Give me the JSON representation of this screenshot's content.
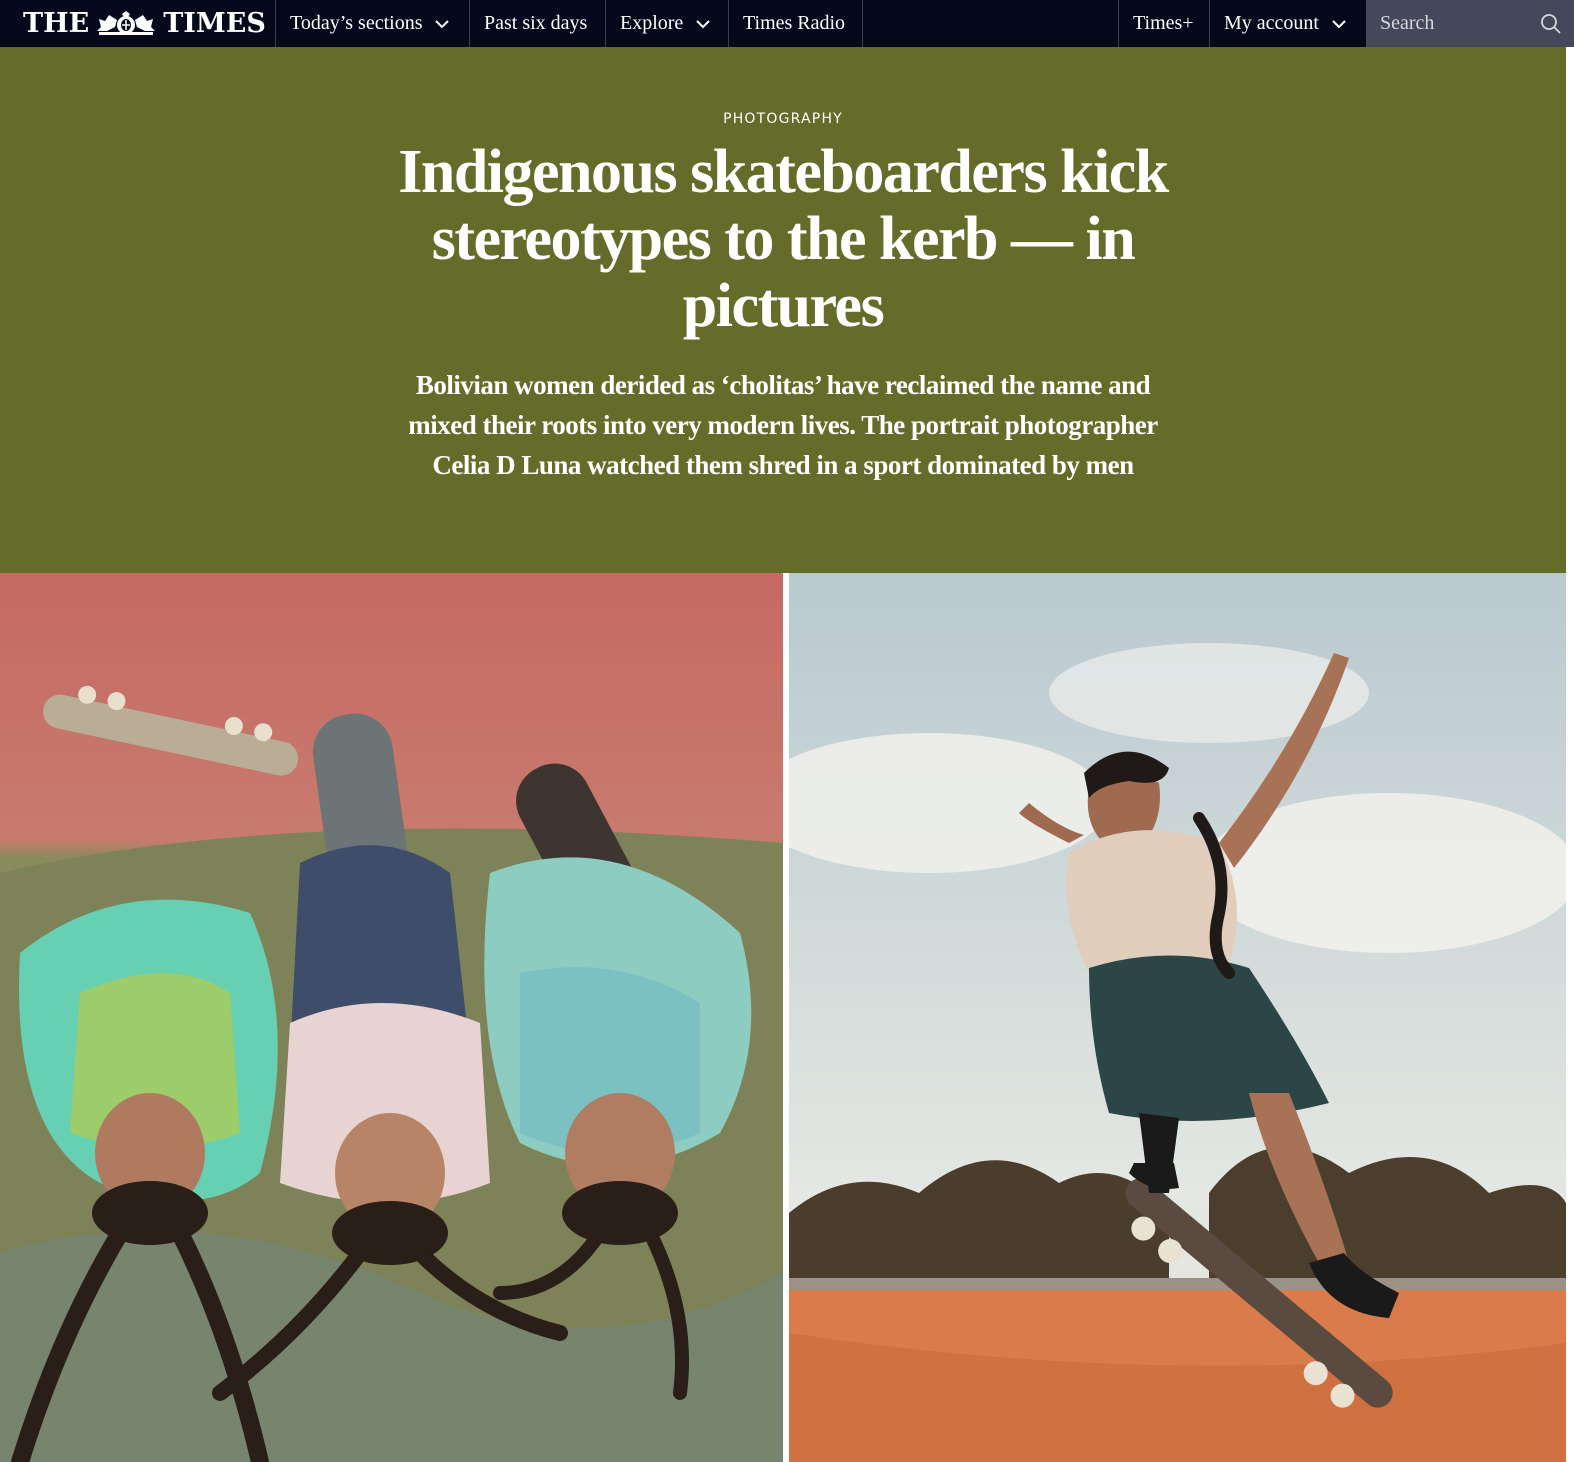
{
  "nav": {
    "logo_left": "THE",
    "logo_right": "TIMES",
    "items": [
      {
        "label": "Today’s sections",
        "has_dropdown": true
      },
      {
        "label": "Past six days",
        "has_dropdown": false
      },
      {
        "label": "Explore",
        "has_dropdown": true
      },
      {
        "label": "Times Radio",
        "has_dropdown": false
      }
    ],
    "right_items": [
      {
        "label": "Times+",
        "has_dropdown": false
      },
      {
        "label": "My account",
        "has_dropdown": true
      }
    ],
    "search_placeholder": "Search"
  },
  "article": {
    "kicker": "PHOTOGRAPHY",
    "headline": "Indigenous skateboarders kick stereotypes to the kerb — in pictures",
    "standfirst": "Bolivian women derided as ‘cholitas’ have reclaimed the name and mixed their roots into very modern lives. The portrait photographer Celia D Luna watched them shred in a sport dominated by men"
  },
  "colors": {
    "nav_bg": "#06081c",
    "hero_bg": "#656c29",
    "search_bg": "#45475a"
  }
}
